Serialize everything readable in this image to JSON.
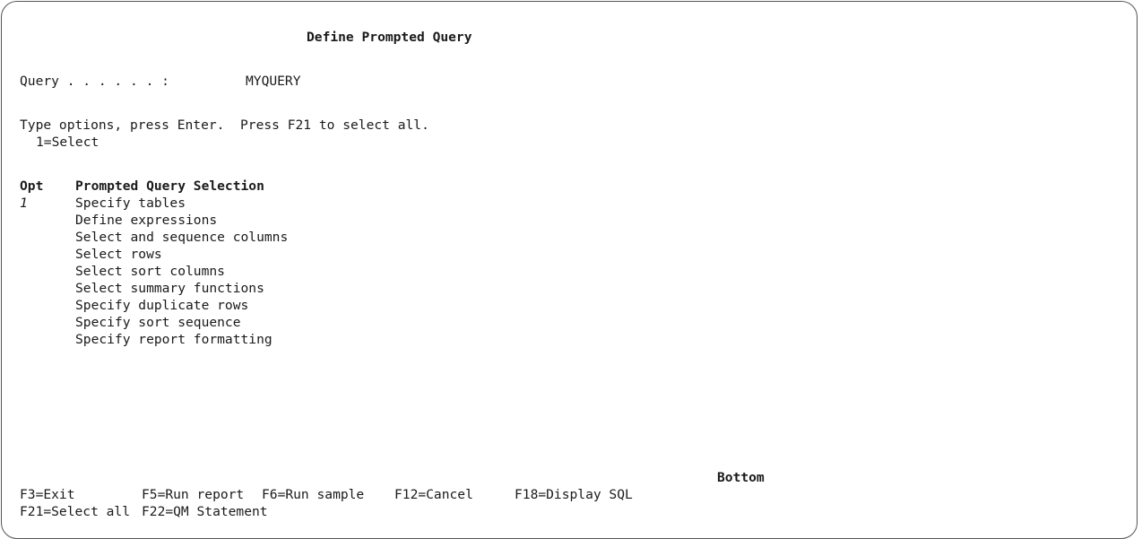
{
  "screen_title": "Define Prompted Query",
  "query": {
    "label": "Query . . . . . . :",
    "value": "MYQUERY"
  },
  "instructions": {
    "line1": "Type options, press Enter.  Press F21 to select all.",
    "line2": "1=Select"
  },
  "list_headers": {
    "opt": "Opt",
    "selection": "Prompted Query Selection"
  },
  "list_items": [
    {
      "opt": "1",
      "label": "Specify tables"
    },
    {
      "opt": "",
      "label": "Define expressions"
    },
    {
      "opt": "",
      "label": "Select and sequence columns"
    },
    {
      "opt": "",
      "label": "Select rows"
    },
    {
      "opt": "",
      "label": "Select sort columns"
    },
    {
      "opt": "",
      "label": "Select summary functions"
    },
    {
      "opt": "",
      "label": "Specify duplicate rows"
    },
    {
      "opt": "",
      "label": "Specify sort sequence"
    },
    {
      "opt": "",
      "label": "Specify report formatting"
    }
  ],
  "scroll_indicator": "Bottom",
  "function_keys": {
    "f3": "F3=Exit",
    "f5": "F5=Run report",
    "f6": "F6=Run sample",
    "f12": "F12=Cancel",
    "f18": "F18=Display SQL",
    "f21": "F21=Select all",
    "f22": "F22=QM Statement"
  }
}
